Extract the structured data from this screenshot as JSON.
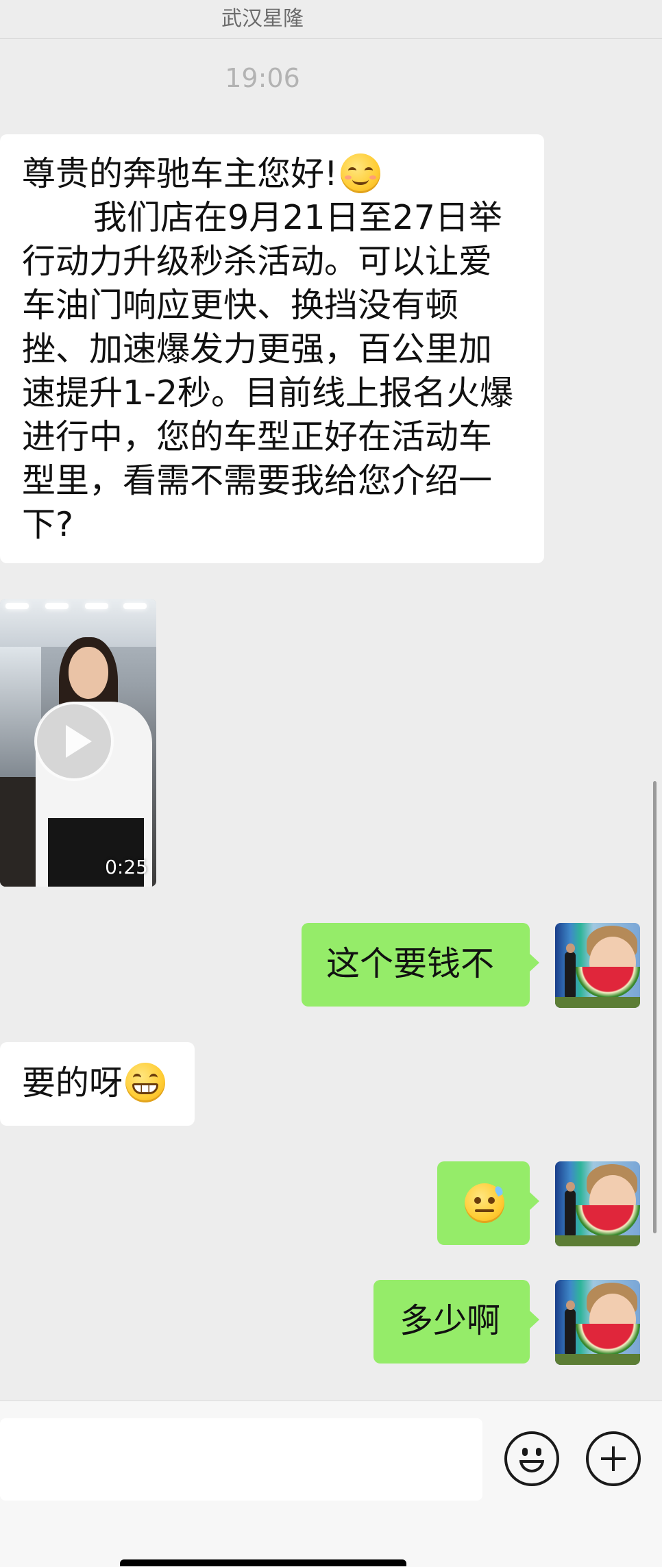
{
  "header": {
    "title": "武汉星隆"
  },
  "timestamp": "19:06",
  "messages": {
    "promo_greeting": "尊贵的奔驰车主您好!",
    "promo_body": "我们店在9月21日至27日举行动力升级秒杀活动。可以让爱车油门响应更快、换挡没有顿挫、加速爆发力更强，百公里加速提升1-2秒。目前线上报名火爆进行中，您的车型正好在活动车型里，看需不需要我给您介绍一下?",
    "video_duration": "0:25",
    "reply_cost_question": "这个要钱不",
    "reply_yes": "要的呀",
    "reply_how_much": "多少啊"
  },
  "icons": {
    "greeting_emoji": "smiling-face-emoji",
    "yes_emoji": "grinning-face-emoji",
    "awkward_emoji": "awkward-face-emoji",
    "input_emoji": "emoji-icon",
    "input_plus": "plus-icon"
  },
  "colors": {
    "background": "#ededed",
    "incoming_bubble": "#ffffff",
    "outgoing_bubble": "#95ec69"
  }
}
